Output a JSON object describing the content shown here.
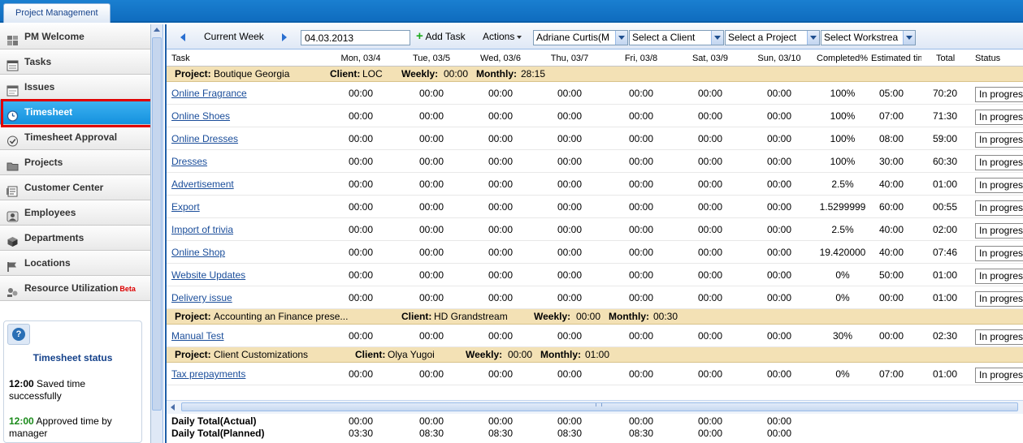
{
  "app": {
    "tab_label": "Project Management"
  },
  "sidebar": {
    "items": [
      {
        "label": "PM Welcome",
        "icon": "dashboard-icon"
      },
      {
        "label": "Tasks",
        "icon": "tasks-icon"
      },
      {
        "label": "Issues",
        "icon": "issues-icon"
      },
      {
        "label": "Timesheet",
        "icon": "clock-icon",
        "active": true
      },
      {
        "label": "Timesheet Approval",
        "icon": "check-circle-icon"
      },
      {
        "label": "Projects",
        "icon": "folder-icon"
      },
      {
        "label": "Customer Center",
        "icon": "customer-icon"
      },
      {
        "label": "Employees",
        "icon": "employees-icon"
      },
      {
        "label": "Departments",
        "icon": "cube-icon"
      },
      {
        "label": "Locations",
        "icon": "flag-icon"
      },
      {
        "label": "Resource Utilization",
        "icon": "resource-icon",
        "badge": "Beta"
      }
    ],
    "status_panel": {
      "title": "Timesheet status",
      "messages": [
        {
          "time": "12:00",
          "text": "Saved time successfully"
        },
        {
          "time": "12:00",
          "text": "Approved time by manager"
        }
      ]
    }
  },
  "toolbar": {
    "week_label": "Current Week",
    "date_value": "04.03.2013",
    "add_task_label": "Add Task",
    "actions_label": "Actions",
    "employee_value": "Adriane Curtis(M",
    "client_value": "Select a Client",
    "project_value": "Select a Project",
    "workstream_value": "Select Workstrea"
  },
  "grid": {
    "columns": [
      "Task",
      "Mon, 03/4",
      "Tue, 03/5",
      "Wed, 03/6",
      "Thu, 03/7",
      "Fri, 03/8",
      "Sat, 03/9",
      "Sun, 03/10",
      "Completed%",
      "Estimated tim",
      "Total",
      "Status"
    ],
    "labels": {
      "project": "Project:",
      "client": "Client:",
      "weekly": "Weekly:",
      "monthly": "Monthly:"
    },
    "groups": [
      {
        "project": "Boutique Georgia",
        "client": "LOC",
        "weekly": "00:00",
        "monthly": "28:15",
        "tasks": [
          {
            "name": "Online Fragrance",
            "days": [
              "00:00",
              "00:00",
              "00:00",
              "00:00",
              "00:00",
              "00:00",
              "00:00"
            ],
            "completed": "100%",
            "estimated": "05:00",
            "total": "70:20",
            "status": "In progress"
          },
          {
            "name": "Online Shoes",
            "days": [
              "00:00",
              "00:00",
              "00:00",
              "00:00",
              "00:00",
              "00:00",
              "00:00"
            ],
            "completed": "100%",
            "estimated": "07:00",
            "total": "71:30",
            "status": "In progress"
          },
          {
            "name": "Online Dresses",
            "days": [
              "00:00",
              "00:00",
              "00:00",
              "00:00",
              "00:00",
              "00:00",
              "00:00"
            ],
            "completed": "100%",
            "estimated": "08:00",
            "total": "59:00",
            "status": "In progress"
          },
          {
            "name": "Dresses",
            "days": [
              "00:00",
              "00:00",
              "00:00",
              "00:00",
              "00:00",
              "00:00",
              "00:00"
            ],
            "completed": "100%",
            "estimated": "30:00",
            "total": "60:30",
            "status": "In progress"
          },
          {
            "name": "Advertisement",
            "days": [
              "00:00",
              "00:00",
              "00:00",
              "00:00",
              "00:00",
              "00:00",
              "00:00"
            ],
            "completed": "2.5%",
            "estimated": "40:00",
            "total": "01:00",
            "status": "In progress"
          },
          {
            "name": "Export",
            "days": [
              "00:00",
              "00:00",
              "00:00",
              "00:00",
              "00:00",
              "00:00",
              "00:00"
            ],
            "completed": "1.5299999",
            "estimated": "60:00",
            "total": "00:55",
            "status": "In progress"
          },
          {
            "name": "Import of trivia",
            "days": [
              "00:00",
              "00:00",
              "00:00",
              "00:00",
              "00:00",
              "00:00",
              "00:00"
            ],
            "completed": "2.5%",
            "estimated": "40:00",
            "total": "02:00",
            "status": "In progress"
          },
          {
            "name": "Online Shop",
            "days": [
              "00:00",
              "00:00",
              "00:00",
              "00:00",
              "00:00",
              "00:00",
              "00:00"
            ],
            "completed": "19.420000",
            "estimated": "40:00",
            "total": "07:46",
            "status": "In progress"
          },
          {
            "name": "Website Updates",
            "days": [
              "00:00",
              "00:00",
              "00:00",
              "00:00",
              "00:00",
              "00:00",
              "00:00"
            ],
            "completed": "0%",
            "estimated": "50:00",
            "total": "01:00",
            "status": "In progress"
          },
          {
            "name": "Delivery issue",
            "days": [
              "00:00",
              "00:00",
              "00:00",
              "00:00",
              "00:00",
              "00:00",
              "00:00"
            ],
            "completed": "0%",
            "estimated": "00:00",
            "total": "01:00",
            "status": "In progress"
          }
        ]
      },
      {
        "project": "Accounting an Finance prese...",
        "client": "HD Grandstream",
        "weekly": "00:00",
        "monthly": "00:30",
        "tasks": [
          {
            "name": "Manual Test",
            "days": [
              "00:00",
              "00:00",
              "00:00",
              "00:00",
              "00:00",
              "00:00",
              "00:00"
            ],
            "completed": "30%",
            "estimated": "00:00",
            "total": "02:30",
            "status": "In progress"
          }
        ]
      },
      {
        "project": "Client Customizations",
        "client": "Olya Yugoi",
        "weekly": "00:00",
        "monthly": "01:00",
        "tasks": [
          {
            "name": "Tax prepayments",
            "days": [
              "00:00",
              "00:00",
              "00:00",
              "00:00",
              "00:00",
              "00:00",
              "00:00"
            ],
            "completed": "0%",
            "estimated": "07:00",
            "total": "01:00",
            "status": "In progress"
          }
        ]
      }
    ],
    "totals": [
      {
        "label": "Daily Total(Actual)",
        "days": [
          "00:00",
          "00:00",
          "00:00",
          "00:00",
          "00:00",
          "00:00",
          "00:00"
        ]
      },
      {
        "label": "Daily Total(Planned)",
        "days": [
          "03:30",
          "08:30",
          "08:30",
          "08:30",
          "08:30",
          "00:00",
          "00:00"
        ]
      }
    ]
  },
  "colors": {
    "accent": "#1591de",
    "project_row": "#f3e1b5",
    "link": "#1a4d9a",
    "highlight": "#e00000"
  }
}
